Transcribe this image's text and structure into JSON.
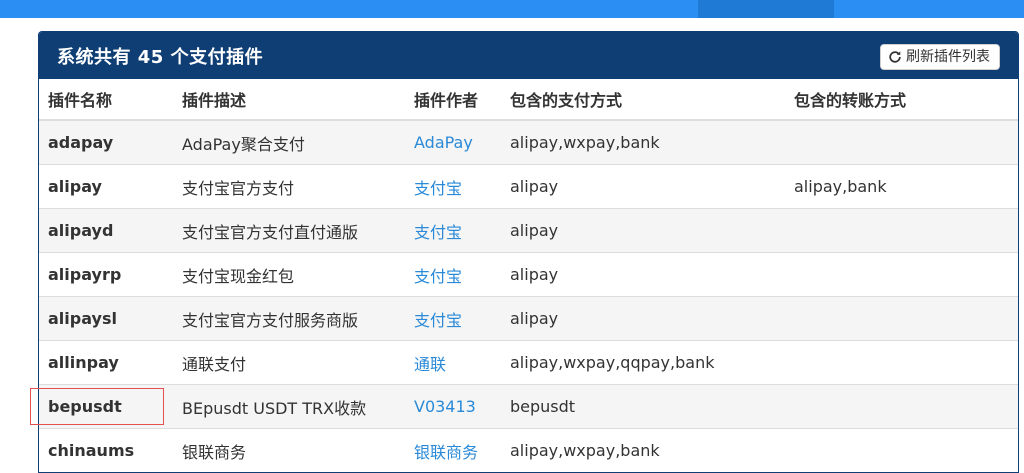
{
  "panel": {
    "title": "系统共有 45 个支付插件",
    "refresh_label": "刷新插件列表"
  },
  "table": {
    "headers": [
      "插件名称",
      "插件描述",
      "插件作者",
      "包含的支付方式",
      "包含的转账方式"
    ],
    "rows": [
      {
        "name": "adapay",
        "desc": "AdaPay聚合支付",
        "author": "AdaPay",
        "pay": "alipay,wxpay,bank",
        "transfer": ""
      },
      {
        "name": "alipay",
        "desc": "支付宝官方支付",
        "author": "支付宝",
        "pay": "alipay",
        "transfer": "alipay,bank"
      },
      {
        "name": "alipayd",
        "desc": "支付宝官方支付直付通版",
        "author": "支付宝",
        "pay": "alipay",
        "transfer": ""
      },
      {
        "name": "alipayrp",
        "desc": "支付宝现金红包",
        "author": "支付宝",
        "pay": "alipay",
        "transfer": ""
      },
      {
        "name": "alipaysl",
        "desc": "支付宝官方支付服务商版",
        "author": "支付宝",
        "pay": "alipay",
        "transfer": ""
      },
      {
        "name": "allinpay",
        "desc": "通联支付",
        "author": "通联",
        "pay": "alipay,wxpay,qqpay,bank",
        "transfer": ""
      },
      {
        "name": "bepusdt",
        "desc": "BEpusdt USDT TRX收款",
        "author": "V03413",
        "pay": "bepusdt",
        "transfer": ""
      },
      {
        "name": "chinaums",
        "desc": "银联商务",
        "author": "银联商务",
        "pay": "alipay,wxpay,bank",
        "transfer": ""
      }
    ]
  },
  "icons": {
    "refresh": "refresh-icon"
  },
  "colors": {
    "topbar": "#2a8ef2",
    "panel_header": "#0e3e74",
    "author_link": "#2a8ad8",
    "highlight": "#e2504f"
  }
}
